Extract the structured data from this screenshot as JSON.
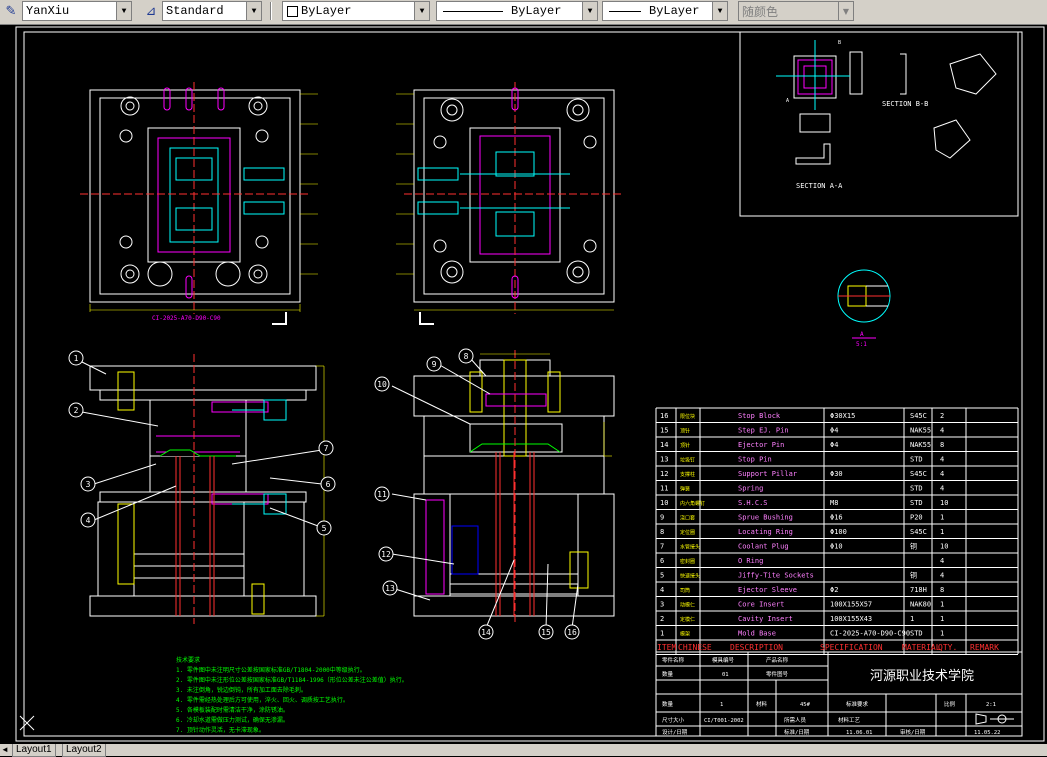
{
  "toolbar": {
    "text_style_icon": "text-style-icon",
    "text_style": "YanXiu",
    "dim_style_icon": "dim-style-icon",
    "dim_style": "Standard",
    "layer": "ByLayer",
    "linetype": "ByLayer",
    "lineweight": "ByLayer",
    "color": "随颜色"
  },
  "drawing": {
    "top_left_label": "CI-2025-A70-D90-C90",
    "section_bb": "SECTION B-B",
    "section_aa": "SECTION A-A",
    "section_a_mark": "A",
    "section_b_mark": "B",
    "detail_label": "A",
    "detail_scale": "5:1",
    "callouts": [
      "1",
      "2",
      "3",
      "4",
      "5",
      "6",
      "7",
      "8",
      "9",
      "10",
      "11",
      "12",
      "13",
      "14",
      "15",
      "16"
    ],
    "notes_title": "技术要求",
    "notes": [
      "1. 零件图中未注明尺寸公差按国家标准GB/T1804-2000中等级执行。",
      "2. 零件图中未注形位公差按国家标准GB/T1184-1996（形位公差未注公差值）执行。",
      "3. 未注倒角，锐边倒钝，所有加工面去除毛刺。",
      "4. 零件需经热处理后方可使用，淬火、回火、调质按工艺执行。",
      "5. 各模板装配时需清洁干净，涂防锈油。",
      "6. 冷却水道需做压力测试，确保无渗漏。",
      "7. 顶针动作灵活，无卡滞现象。"
    ]
  },
  "bom": {
    "rows": [
      [
        "16",
        "限位块",
        "Stop Block",
        "Φ30X15",
        "S45C",
        "2"
      ],
      [
        "15",
        "顶针",
        "Step EJ. Pin",
        "Φ4",
        "NAK55",
        "4"
      ],
      [
        "14",
        "顶针",
        "Ejector Pin",
        "Φ4",
        "NAK55",
        "8"
      ],
      [
        "13",
        "垃圾钉",
        "Stop Pin",
        "",
        "STD",
        "4"
      ],
      [
        "12",
        "支撑柱",
        "Support Pillar",
        "Φ30",
        "S45C",
        "4"
      ],
      [
        "11",
        "弹簧",
        "Spring",
        "",
        "STD",
        "4"
      ],
      [
        "10",
        "内六角螺钉",
        "S.H.C.S",
        "M8",
        "STD",
        "10"
      ],
      [
        "9",
        "浇口套",
        "Sprue Bushing",
        "Φ16",
        "P20",
        "1"
      ],
      [
        "8",
        "定位圈",
        "Locating Ring",
        "Φ100",
        "S45C",
        "1"
      ],
      [
        "7",
        "水管接头",
        "Coolant Plug",
        "Φ10",
        "铜",
        "10"
      ],
      [
        "6",
        "密封圈",
        "O Ring",
        "",
        "",
        "4"
      ],
      [
        "5",
        "快速接头",
        "Jiffy-Tite Sockets",
        "",
        "铜",
        "4"
      ],
      [
        "4",
        "司筒",
        "Ejector Sleeve",
        "Φ2",
        "718H",
        "8"
      ],
      [
        "3",
        "动模仁",
        "Core Insert",
        "100X155X57",
        "NAK80",
        "1"
      ],
      [
        "2",
        "定模仁",
        "Cavity Insert",
        "100X155X43",
        "1",
        "1"
      ],
      [
        "1",
        "模架",
        "Mold Base",
        "CI-2025-A70-D90-C90",
        "STD",
        "1"
      ]
    ],
    "header": [
      "ITEM",
      "CHINESE",
      "DESCRIPTION",
      "SPECIFICATION",
      "MATERIAL",
      "QTY.",
      "REMARK"
    ]
  },
  "title_block": {
    "school": "河源职业技术学院",
    "r1": [
      "零件名称",
      "模具编号",
      "产品名称"
    ],
    "r2": [
      "数量",
      "01",
      "零件图号"
    ],
    "r3": [
      "数量",
      "1",
      "材料",
      "45#",
      "标准要求",
      "比例",
      "2:1"
    ],
    "r4": [
      "尺寸大小",
      "CI/T001-2002",
      "所需人员",
      "材料工艺"
    ],
    "r5": [
      "设计/日期",
      "标准/日期",
      "11.06.01",
      "审核/日期",
      "11.05.22"
    ]
  },
  "layout_tabs": {
    "nav": "◄",
    "tab1": "Layout1",
    "tab2": "Layout2"
  },
  "colors": {
    "background": "#000000",
    "white": "#ffffff",
    "cyan": "#00ffff",
    "magenta": "#ff00ff",
    "red": "#ff3030",
    "green": "#00ff00",
    "yellow": "#ffff00"
  }
}
